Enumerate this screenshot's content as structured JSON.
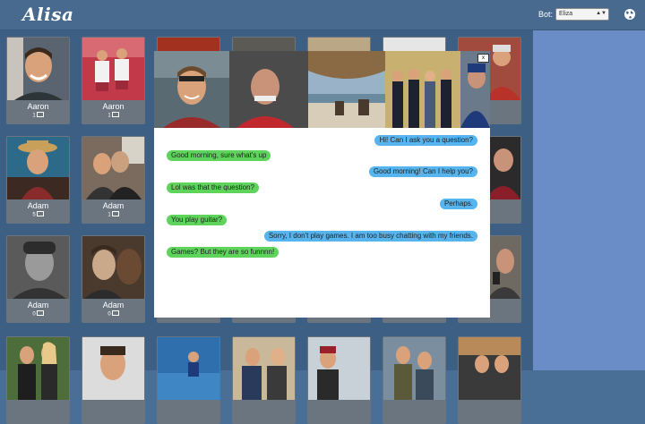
{
  "app": {
    "logo": "Alisa"
  },
  "header": {
    "bot_label": "Bot:",
    "bot_selected": "Eliza",
    "globe_icon": "globe-icon"
  },
  "tiles": [
    {
      "name": "Aaron",
      "count": "1"
    },
    {
      "name": "Aaron",
      "count": "1"
    },
    {
      "name": "Adam",
      "count": "5"
    },
    {
      "name": "Adam",
      "count": "1"
    },
    {
      "name": "Adam",
      "count": "0"
    },
    {
      "name": "Adam",
      "count": "0"
    }
  ],
  "modal": {
    "close_label": "x",
    "messages": [
      {
        "from": "user",
        "text": "Hi! Can I ask you a question?"
      },
      {
        "from": "bot",
        "text": "Good morning, sure what's up"
      },
      {
        "from": "user",
        "text": "Good morning! Can I help you?"
      },
      {
        "from": "bot",
        "text": "Lol was that the question?"
      },
      {
        "from": "user",
        "text": "Perhaps."
      },
      {
        "from": "bot",
        "text": "You play guitar?"
      },
      {
        "from": "user",
        "text": "Sorry, I don't play games. I am too busy chatting with my friends."
      },
      {
        "from": "bot",
        "text": "Games? But they are so funnnn!"
      }
    ]
  },
  "colors": {
    "user_bubble": "#56b4ee",
    "bot_bubble": "#5fd45c",
    "header": "#486a8e",
    "sidebar": "#6a8dc8"
  }
}
